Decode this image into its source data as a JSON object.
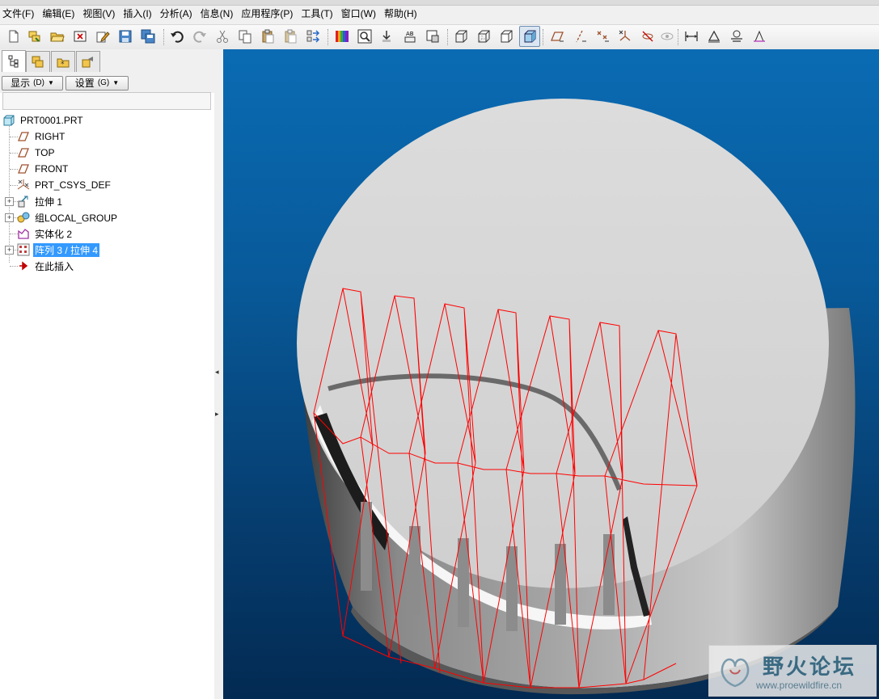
{
  "menu": [
    "文件(F)",
    "编辑(E)",
    "视图(V)",
    "插入(I)",
    "分析(A)",
    "信息(N)",
    "应用程序(P)",
    "工具(T)",
    "窗口(W)",
    "帮助(H)"
  ],
  "panel": {
    "display_label": "显示",
    "display_key": "(D)",
    "settings_label": "设置",
    "settings_key": "(G)"
  },
  "tree": [
    {
      "label": "PRT0001.PRT",
      "icon": "part-icon"
    },
    {
      "label": "RIGHT",
      "icon": "datum-plane-icon"
    },
    {
      "label": "TOP",
      "icon": "datum-plane-icon"
    },
    {
      "label": "FRONT",
      "icon": "datum-plane-icon"
    },
    {
      "label": "PRT_CSYS_DEF",
      "icon": "csys-icon"
    },
    {
      "label": "拉伸 1",
      "icon": "extrude-icon"
    },
    {
      "label": "组LOCAL_GROUP",
      "icon": "group-icon"
    },
    {
      "label": "实体化 2",
      "icon": "solidify-icon"
    },
    {
      "label": "阵列 3 / 拉伸 4",
      "icon": "pattern-icon",
      "selected": true
    },
    {
      "label": "在此插入",
      "icon": "insert-here-arrow-icon"
    }
  ],
  "watermark": {
    "title": "野火论坛",
    "url": "www.proewildfire.cn"
  },
  "colors": {
    "selection": "#3399ff",
    "viewport_top": "#0a6bb3",
    "viewport_bottom": "#032a52",
    "preview_outline": "#ff0000",
    "model_surface": "#d8d8d8"
  }
}
